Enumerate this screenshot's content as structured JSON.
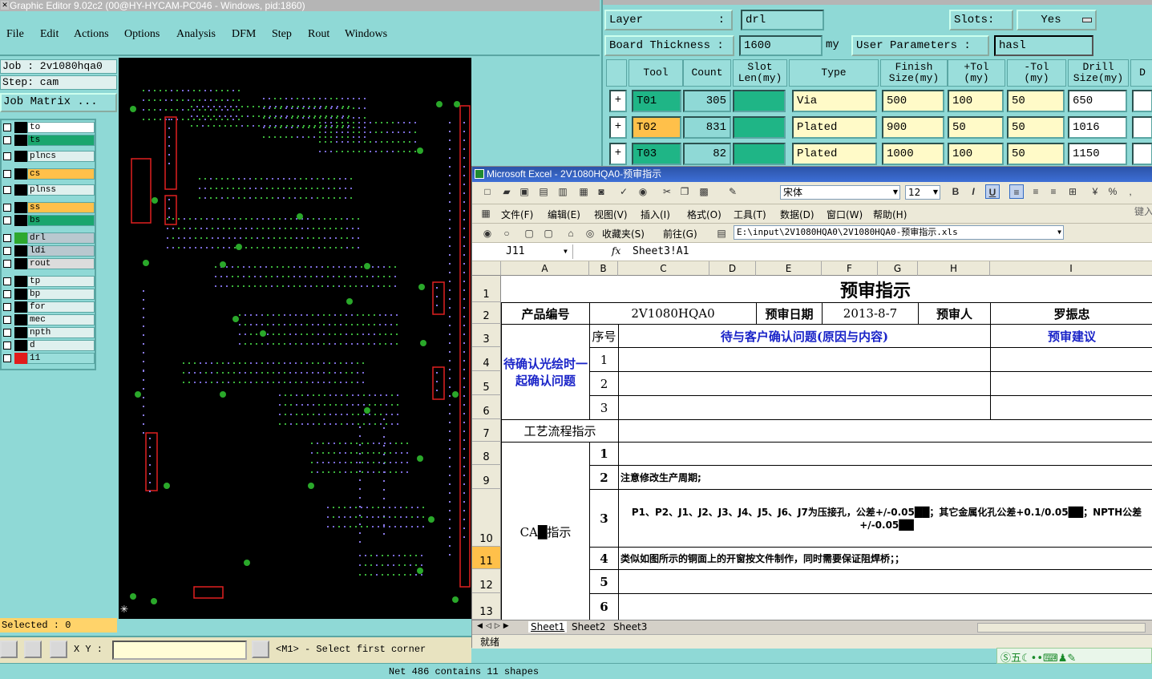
{
  "graphic_editor": {
    "title": "Graphic Editor 9.02c2 (00@HY-HYCAM-PC046 - Windows, pid:1860)",
    "menu": [
      "File",
      "Edit",
      "Actions",
      "Options",
      "Analysis",
      "DFM",
      "Step",
      "Rout",
      "Windows"
    ],
    "job_line": "Job : 2v1080hqa0",
    "step_line": "Step: cam",
    "job_matrix_label": "Job Matrix ...",
    "layers": [
      {
        "name": "to",
        "swatch": "#000000",
        "bg": "#ffffff"
      },
      {
        "name": "ts",
        "swatch": "#000000",
        "bg": "#1aa66e"
      },
      {
        "name": "plncs",
        "swatch": "#000000",
        "bg": "#dff0ee"
      },
      {
        "name": "cs",
        "swatch": "#000000",
        "bg": "#ffc04a"
      },
      {
        "name": "plnss",
        "swatch": "#000000",
        "bg": "#dff0ee"
      },
      {
        "name": "ss",
        "swatch": "#000000",
        "bg": "#ffc04a"
      },
      {
        "name": "bs",
        "swatch": "#000000",
        "bg": "#1aa66e"
      },
      {
        "name": "drl",
        "swatch": "#2ea82e",
        "bg": "#b9c8cf"
      },
      {
        "name": "ldi",
        "swatch": "#000000",
        "bg": "#b9c8cf"
      },
      {
        "name": "rout",
        "swatch": "#000000",
        "bg": "#dcdcdc"
      },
      {
        "name": "tp",
        "swatch": "#000000",
        "bg": "#dff0ee"
      },
      {
        "name": "bp",
        "swatch": "#000000",
        "bg": "#dff0ee"
      },
      {
        "name": "for",
        "swatch": "#000000",
        "bg": "#dff0ee"
      },
      {
        "name": "mec",
        "swatch": "#000000",
        "bg": "#dff0ee"
      },
      {
        "name": "npth",
        "swatch": "#000000",
        "bg": "#dff0ee"
      },
      {
        "name": "d",
        "swatch": "#000000",
        "bg": "#dff0ee"
      },
      {
        "name": "11",
        "swatch": "#e11c1c",
        "bg": "#9adedb"
      }
    ],
    "selected_text": "Selected : 0",
    "xy_label": "X Y :",
    "prompt": "<M1> - Select first corner",
    "status": "Net 486 contains 11 shapes"
  },
  "drill_manager": {
    "layer_label": "Layer",
    "layer_sep": ":",
    "layer_value": "drl",
    "slots_label": "Slots:",
    "slots_value": "Yes",
    "board_thickness_label": "Board Thickness :",
    "board_thickness_value": "1600",
    "board_thickness_unit": "my",
    "user_params_label": "User Parameters :",
    "user_params_value": "hasl",
    "headers": [
      "Tool",
      "Count",
      "Slot\nLen(my)",
      "Type",
      "Finish\nSize(my)",
      "+Tol\n(my)",
      "-Tol\n(my)",
      "Drill\nSize(my)",
      "D"
    ],
    "rows": [
      {
        "tool": "T01",
        "count": "305",
        "type": "Via",
        "finish": "500",
        "ptol": "100",
        "mtol": "50",
        "drill": "650",
        "highlight": false
      },
      {
        "tool": "T02",
        "count": "831",
        "type": "Plated",
        "finish": "900",
        "ptol": "50",
        "mtol": "50",
        "drill": "1016",
        "highlight": true
      },
      {
        "tool": "T03",
        "count": "82",
        "type": "Plated",
        "finish": "1000",
        "ptol": "100",
        "mtol": "50",
        "drill": "1150",
        "highlight": false
      }
    ]
  },
  "excel": {
    "title": "Microsoft Excel - 2V1080HQA0-预审指示",
    "font_name": "宋体",
    "font_size": "12",
    "menu": [
      "文件(F)",
      "编辑(E)",
      "视图(V)",
      "插入(I)",
      "格式(O)",
      "工具(T)",
      "数据(D)",
      "窗口(W)",
      "帮助(H)"
    ],
    "help_hint": "键入",
    "favorites": "收藏夹(S)",
    "forward": "前往(G)",
    "path": "E:\\input\\2V1080HQA0\\2V1080HQA0-预审指示.xls",
    "name_box": "J11",
    "fx": "fx",
    "formula": "Sheet3!A1",
    "columns": [
      "A",
      "B",
      "C",
      "D",
      "E",
      "F",
      "G",
      "H",
      "I"
    ],
    "row_numbers": [
      "1",
      "2",
      "3",
      "4",
      "5",
      "6",
      "7",
      "8",
      "9",
      "10",
      "11",
      "12",
      "13"
    ],
    "sheet_title": "预审指示",
    "product_label": "产品编号",
    "product_value": "2V1080HQA0",
    "date_label": "预审日期",
    "date_value": "2013-8-7",
    "reviewer_label": "预审人",
    "reviewer_value": "罗振忠",
    "seq_label": "序号",
    "issue_header": "待与客户确认问题(原因与内容)",
    "advice_header": "预审建议",
    "confirm_label": "待确认光绘时一起确认问题",
    "process_label": "工艺流程指示",
    "cam_label": "CAM指示",
    "cam_label_shown": "CA█指示",
    "seq": [
      "1",
      "2",
      "3"
    ],
    "cam_seq": [
      "1",
      "2",
      "3",
      "4",
      "5",
      "6"
    ],
    "cam_items": [
      "",
      "注意修改生产周期;",
      "P1、P2、J1、J2、J3、J4、J5、J6、J7为压接孔，公差+/-0.05██；其它金属化孔公差+0.1/0.05██；NPTH公差+/-0.05██",
      "类似如图所示的铜面上的开窗按文件制作，同时需要保证阻焊桥；；",
      "",
      ""
    ],
    "sheets": [
      "Sheet1",
      "Sheet2",
      "Sheet3"
    ],
    "status": "就绪"
  }
}
